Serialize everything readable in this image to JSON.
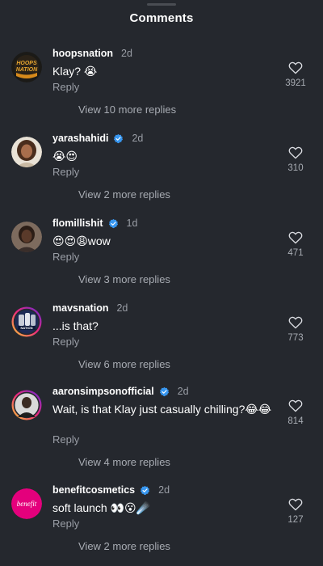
{
  "header": {
    "title": "Comments"
  },
  "comments": [
    {
      "username": "hoopsnation",
      "verified": false,
      "time": "2d",
      "text": "Klay? 😭",
      "reply": "Reply",
      "likes": "3921",
      "view_replies": "View 10 more replies",
      "avatar_logo_text": "HOOPS NATION"
    },
    {
      "username": "yarashahidi",
      "verified": true,
      "time": "2d",
      "text": "😭😍",
      "reply": "Reply",
      "likes": "310",
      "view_replies": "View 2 more replies"
    },
    {
      "username": "flomillishit",
      "verified": true,
      "time": "1d",
      "text": "😍😍😩wow",
      "reply": "Reply",
      "likes": "471",
      "view_replies": "View 3 more replies"
    },
    {
      "username": "mavsnation",
      "verified": false,
      "time": "2d",
      "text": "...is that?",
      "reply": "Reply",
      "likes": "773",
      "view_replies": "View 6 more replies"
    },
    {
      "username": "aaronsimpsonofficial",
      "verified": true,
      "time": "2d",
      "text": "Wait, is that Klay just casually chilling?😂😂",
      "reply": "Reply",
      "likes": "814",
      "view_replies": "View 4 more replies"
    },
    {
      "username": "benefitcosmetics",
      "verified": true,
      "time": "2d",
      "text": "soft launch 👀😮☄️",
      "reply": "Reply",
      "likes": "127",
      "view_replies": "View 2 more replies",
      "avatar_logo_text": "benefit"
    }
  ],
  "colors": {
    "background": "#25282e",
    "verified": "#3897f0",
    "muted_text": "#9a9ea6",
    "story_ring": "#d6249f"
  },
  "icons": [
    "verified-badge-icon",
    "heart-outline-icon"
  ]
}
